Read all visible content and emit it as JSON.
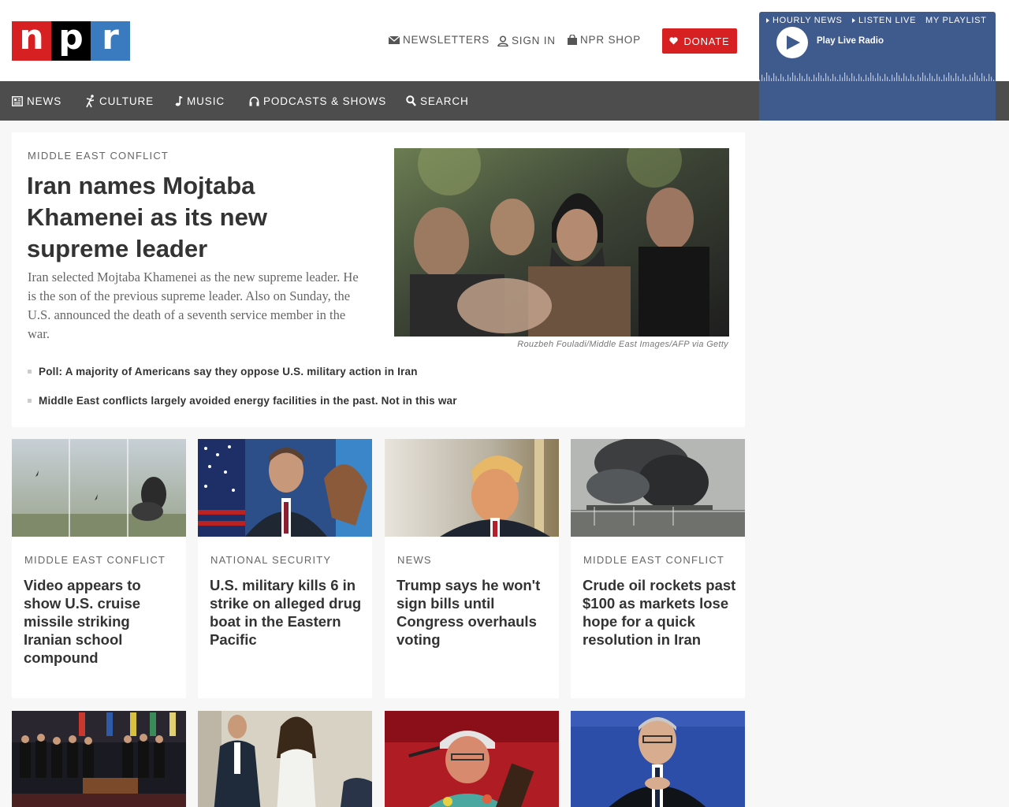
{
  "header": {
    "logo": [
      "n",
      "p",
      "r"
    ],
    "newsletters": "NEWSLETTERS",
    "sign_in": "SIGN IN",
    "shop": "NPR SHOP",
    "donate": "DONATE"
  },
  "nav": {
    "items": [
      {
        "label": "NEWS",
        "icon": "newspaper-icon"
      },
      {
        "label": "CULTURE",
        "icon": "figure-icon"
      },
      {
        "label": "MUSIC",
        "icon": "music-note-icon"
      },
      {
        "label": "PODCASTS & SHOWS",
        "icon": "headphones-icon"
      },
      {
        "label": "SEARCH",
        "icon": "search-icon"
      }
    ]
  },
  "player": {
    "play_label": "Play Live Radio",
    "links": [
      "HOURLY NEWS",
      "LISTEN LIVE",
      "MY PLAYLIST"
    ]
  },
  "hero": {
    "slug": "MIDDLE EAST CONFLICT",
    "title": "Iran names Mojtaba Khamenei as its new supreme leader",
    "teaser": "Iran selected Mojtaba Khamenei as the new supreme leader. He is the son of the previous supreme leader. Also on Sunday, the U.S. announced the death of a seventh service member in the war.",
    "credit": "Rouzbeh Fouladi/Middle East Images/AFP via Getty",
    "related": [
      "Poll: A majority of Americans say they oppose U.S. military action in Iran",
      "Middle East conflicts largely avoided energy facilities in the past. Not in this war"
    ]
  },
  "stories": [
    {
      "slug": "MIDDLE EAST CONFLICT",
      "title": "Video appears to show U.S. cruise missile striking Iranian school compound"
    },
    {
      "slug": "NATIONAL SECURITY",
      "title": "U.S. military kills 6 in strike on alleged drug boat in the Eastern Pacific"
    },
    {
      "slug": "NEWS",
      "title": "Trump says he won't sign bills until Congress overhauls voting"
    },
    {
      "slug": "MIDDLE EAST CONFLICT",
      "title": "Crude oil rockets past $100 as markets lose hope for a quick resolution in Iran"
    }
  ],
  "colors": {
    "brand_red": "#d62021",
    "brand_blue": "#3a7bbf",
    "nav_bg": "#4d4d4d",
    "player_bg": "#3f5a8c"
  }
}
